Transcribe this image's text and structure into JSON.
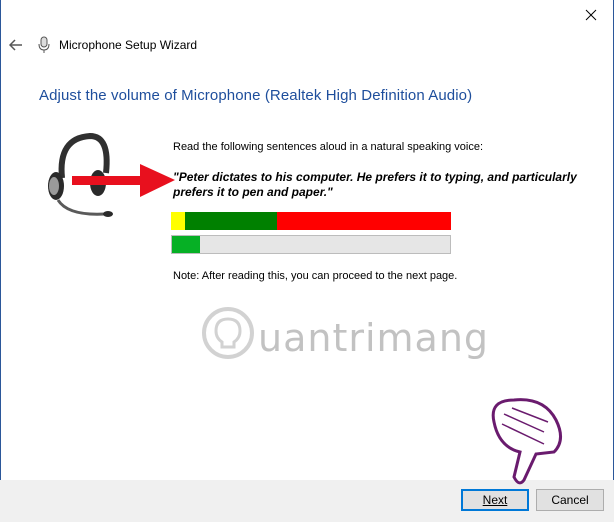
{
  "window": {
    "title": "Microphone Setup Wizard",
    "heading": "Adjust the volume of Microphone (Realtek High Definition Audio)"
  },
  "content": {
    "instruction": "Read the following sentences aloud in a natural speaking voice:",
    "quote": "\"Peter dictates to his computer. He prefers it to typing, and particularly prefers it to pen and paper.\"",
    "note": "Note: After reading this, you can proceed to the next page."
  },
  "meter": {
    "segments": [
      {
        "name": "low",
        "color": "#ffff00",
        "fraction": 0.05
      },
      {
        "name": "good",
        "color": "#008000",
        "fraction": 0.33
      },
      {
        "name": "high",
        "color": "#ff0000",
        "fraction": 0.62
      }
    ]
  },
  "level": {
    "value": 0.1,
    "color": "#06b025"
  },
  "watermark": {
    "text": "uantrimang"
  },
  "buttons": {
    "next": "Next",
    "cancel": "Cancel"
  },
  "icons": [
    "back-arrow-icon",
    "microphone-icon",
    "close-icon",
    "headset-icon",
    "red-arrow-icon",
    "pointing-hand-icon"
  ]
}
